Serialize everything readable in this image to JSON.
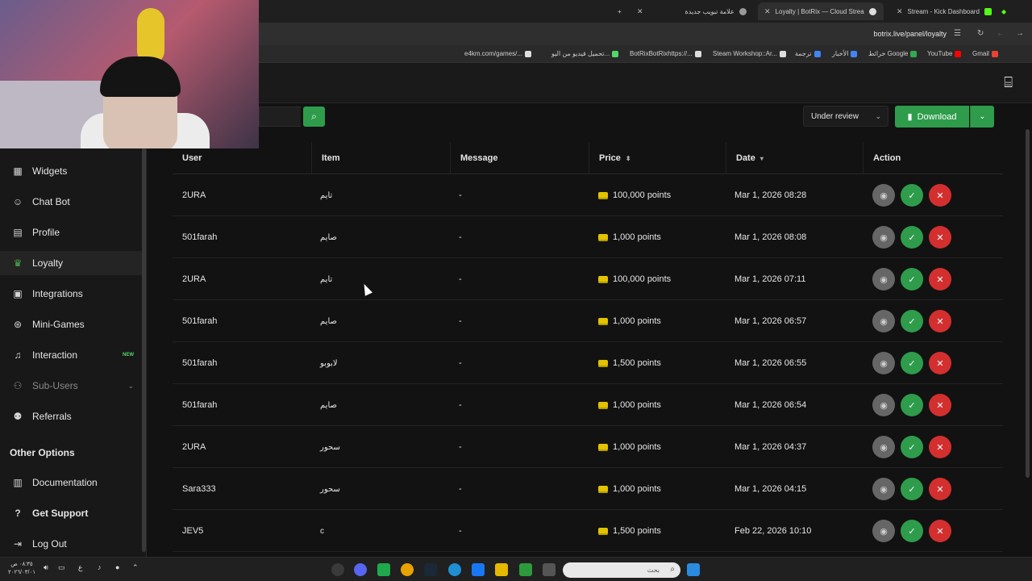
{
  "browser": {
    "tabs": [
      {
        "title": "Stream - Kick Dashboard",
        "active": false
      },
      {
        "title": "Loyalty | BotRix — Cloud Strea",
        "active": true
      },
      {
        "title": "علامة تبويب جديدة",
        "active": false
      }
    ],
    "url": "botrix.live/panel/loyalty",
    "bookmarks": [
      "Gmail",
      "YouTube",
      "خرائط Google",
      "الأخبار",
      "ترجمة",
      "Steam Workshop::Ar...",
      "BotRixBotRixhttps://...",
      "تحميل فيديو من اليو...",
      "e4km.com/games/..."
    ]
  },
  "sidebar": {
    "items": [
      {
        "label": "Widgets",
        "icon": "grid-icon"
      },
      {
        "label": "Chat Bot",
        "icon": "robot-icon"
      },
      {
        "label": "Profile",
        "icon": "id-card-icon"
      },
      {
        "label": "Loyalty",
        "icon": "trophy-icon",
        "active": true
      },
      {
        "label": "Integrations",
        "icon": "plugin-icon"
      },
      {
        "label": "Mini-Games",
        "icon": "gamepad-icon"
      },
      {
        "label": "Interaction",
        "icon": "music-icon",
        "badge": "NEW"
      },
      {
        "label": "Sub-Users",
        "icon": "users-icon",
        "dim": true
      },
      {
        "label": "Referrals",
        "icon": "user-group-icon"
      }
    ],
    "other_title": "Other Options",
    "other_items": [
      {
        "label": "Documentation",
        "icon": "book-icon"
      },
      {
        "label": "Get Support",
        "icon": "help-icon"
      },
      {
        "label": "Log Out",
        "icon": "logout-icon"
      }
    ]
  },
  "toolbar": {
    "status_value": "Under review",
    "download_label": "Download"
  },
  "table": {
    "columns": [
      "User",
      "Item",
      "Message",
      "Price",
      "Date",
      "Action"
    ],
    "rows": [
      {
        "user": "2URA",
        "item": "تايم",
        "message": "-",
        "price": "100,000 points",
        "date": "Mar 1, 2026 08:28"
      },
      {
        "user": "501farah",
        "item": "صايم",
        "message": "-",
        "price": "1,000 points",
        "date": "Mar 1, 2026 08:08"
      },
      {
        "user": "2URA",
        "item": "تايم",
        "message": "-",
        "price": "100,000 points",
        "date": "Mar 1, 2026 07:11"
      },
      {
        "user": "501farah",
        "item": "صايم",
        "message": "-",
        "price": "1,000 points",
        "date": "Mar 1, 2026 06:57"
      },
      {
        "user": "501farah",
        "item": "لابوبو",
        "message": "-",
        "price": "1,500 points",
        "date": "Mar 1, 2026 06:55"
      },
      {
        "user": "501farah",
        "item": "صايم",
        "message": "-",
        "price": "1,000 points",
        "date": "Mar 1, 2026 06:54"
      },
      {
        "user": "2URA",
        "item": "سحور",
        "message": "-",
        "price": "1,000 points",
        "date": "Mar 1, 2026 04:37"
      },
      {
        "user": "Sara333",
        "item": "سحور",
        "message": "-",
        "price": "1,000 points",
        "date": "Mar 1, 2026 04:15"
      },
      {
        "user": "JEV5",
        "item": "c",
        "message": "-",
        "price": "1,500 points",
        "date": "Feb 22, 2026 10:10"
      }
    ]
  },
  "taskbar": {
    "search_placeholder": "بحث",
    "clock_time": "٠٨:٣٥ ص",
    "clock_date": "٢٠٢٦/٠٣/٠١"
  },
  "colors": {
    "accent_green": "#2e9c4b",
    "danger_red": "#d32f2f",
    "background": "#121212"
  }
}
